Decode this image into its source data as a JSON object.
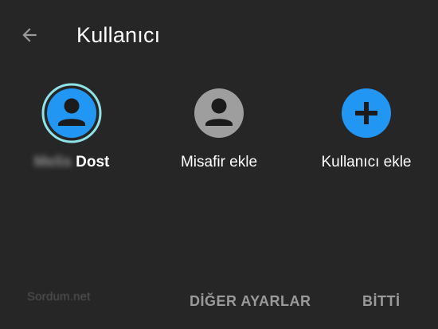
{
  "header": {
    "title": "Kullanıcı",
    "back_icon": "arrow-left-icon"
  },
  "users": [
    {
      "blurred_name": "Melis",
      "name": "Dost",
      "icon": "person-icon",
      "ring_color": "#8fe3e6",
      "fill_color": "#2196f3"
    },
    {
      "name": "Misafir ekle",
      "icon": "person-icon",
      "fill_color": "#9e9e9e"
    },
    {
      "name": "Kullanıcı ekle",
      "icon": "plus-icon",
      "fill_color": "#2196f3"
    }
  ],
  "footer": {
    "watermark": "Sordum.net",
    "more_settings_label": "DİĞER AYARLAR",
    "done_label": "BİTTİ"
  },
  "colors": {
    "background": "#262626",
    "accent": "#2196f3",
    "guest": "#9e9e9e",
    "active_ring": "#8fe3e6",
    "footer_text": "#9a9a9a"
  }
}
